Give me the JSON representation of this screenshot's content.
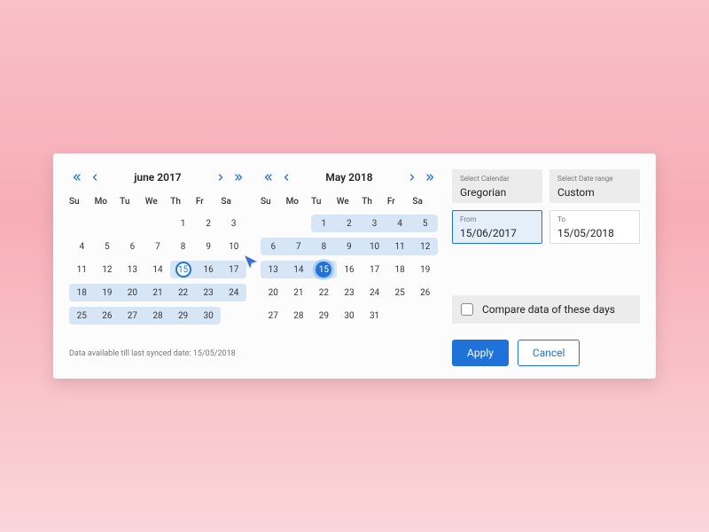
{
  "calendars": {
    "left": {
      "title": "june 2017",
      "dow": [
        "Su",
        "Mo",
        "Tu",
        "We",
        "Th",
        "Fr",
        "Sa"
      ],
      "leading_blanks": 4,
      "days": 30,
      "selected_day": 15,
      "selected_style": "outline",
      "range_start": 15,
      "range_end": 30
    },
    "right": {
      "title": "May 2018",
      "dow": [
        "Su",
        "Mo",
        "Tu",
        "We",
        "Th",
        "Fr",
        "Sa"
      ],
      "leading_blanks": 2,
      "days": 31,
      "selected_day": 15,
      "selected_style": "fill",
      "range_start": 1,
      "range_end": 15
    }
  },
  "footnote": "Data available till last synced date: 15/05/2018",
  "side": {
    "calendar_field": {
      "label": "Select Calendar",
      "value": "Gregorian"
    },
    "range_field": {
      "label": "Select Date range",
      "value": "Custom"
    },
    "from_field": {
      "label": "From",
      "value": "15/06/2017"
    },
    "to_field": {
      "label": "To",
      "value": "15/05/2018"
    },
    "compare_label": "Compare data of these days"
  },
  "actions": {
    "apply": "Apply",
    "cancel": "Cancel"
  }
}
